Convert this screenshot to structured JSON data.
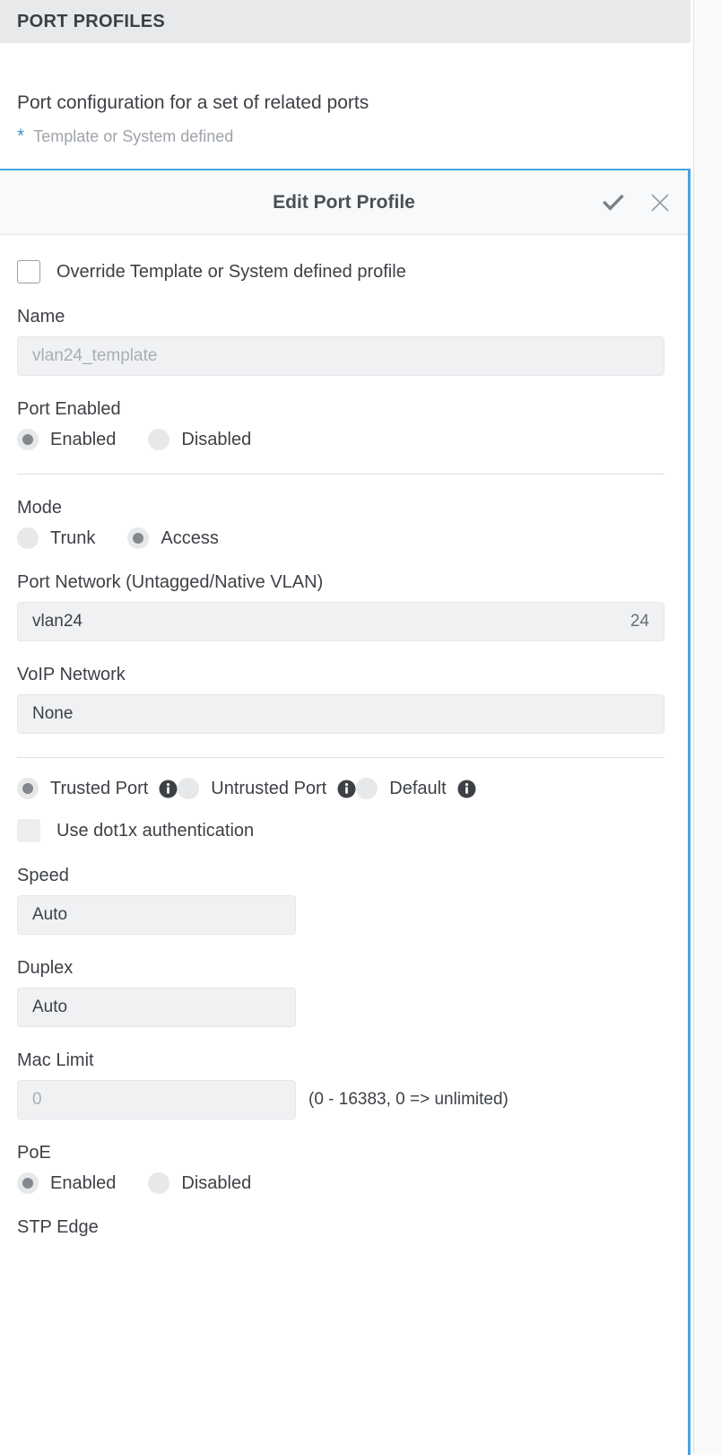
{
  "page": {
    "header_title": "PORT PROFILES",
    "subtitle": "Port configuration for a set of related ports",
    "legend_symbol": "*",
    "legend_text": "Template or System defined"
  },
  "dialog": {
    "title": "Edit Port Profile",
    "confirm_icon": "checkmark-icon",
    "close_icon": "close-icon",
    "override_checkbox": {
      "label": "Override Template or System defined profile",
      "checked": false
    },
    "name": {
      "label": "Name",
      "value": "vlan24_template",
      "placeholder": "vlan24_template"
    },
    "port_enabled": {
      "label": "Port Enabled",
      "options": [
        "Enabled",
        "Disabled"
      ],
      "selected": "Enabled"
    },
    "mode": {
      "label": "Mode",
      "options": [
        "Trunk",
        "Access"
      ],
      "selected": "Access"
    },
    "port_network": {
      "label": "Port Network (Untagged/Native VLAN)",
      "value": "vlan24",
      "vlan_id": "24"
    },
    "voip_network": {
      "label": "VoIP Network",
      "value": "None"
    },
    "trust": {
      "options": [
        "Trusted Port",
        "Untrusted Port",
        "Default"
      ],
      "selected": "Trusted Port",
      "info_icon": "info-icon"
    },
    "dot1x": {
      "label": "Use dot1x authentication",
      "checked": false
    },
    "speed": {
      "label": "Speed",
      "value": "Auto"
    },
    "duplex": {
      "label": "Duplex",
      "value": "Auto"
    },
    "mac_limit": {
      "label": "Mac Limit",
      "value": "0",
      "placeholder": "0",
      "hint": "(0 - 16383, 0 => unlimited)"
    },
    "poe": {
      "label": "PoE",
      "options": [
        "Enabled",
        "Disabled"
      ],
      "selected": "Enabled"
    },
    "stp_edge": {
      "label": "STP Edge"
    }
  },
  "colors": {
    "accent_blue": "#4aa3e0",
    "header_band": "#e8e9eb",
    "field_bg": "#f0f1f3",
    "text": "#3d4146",
    "muted": "#9ea4ab"
  }
}
